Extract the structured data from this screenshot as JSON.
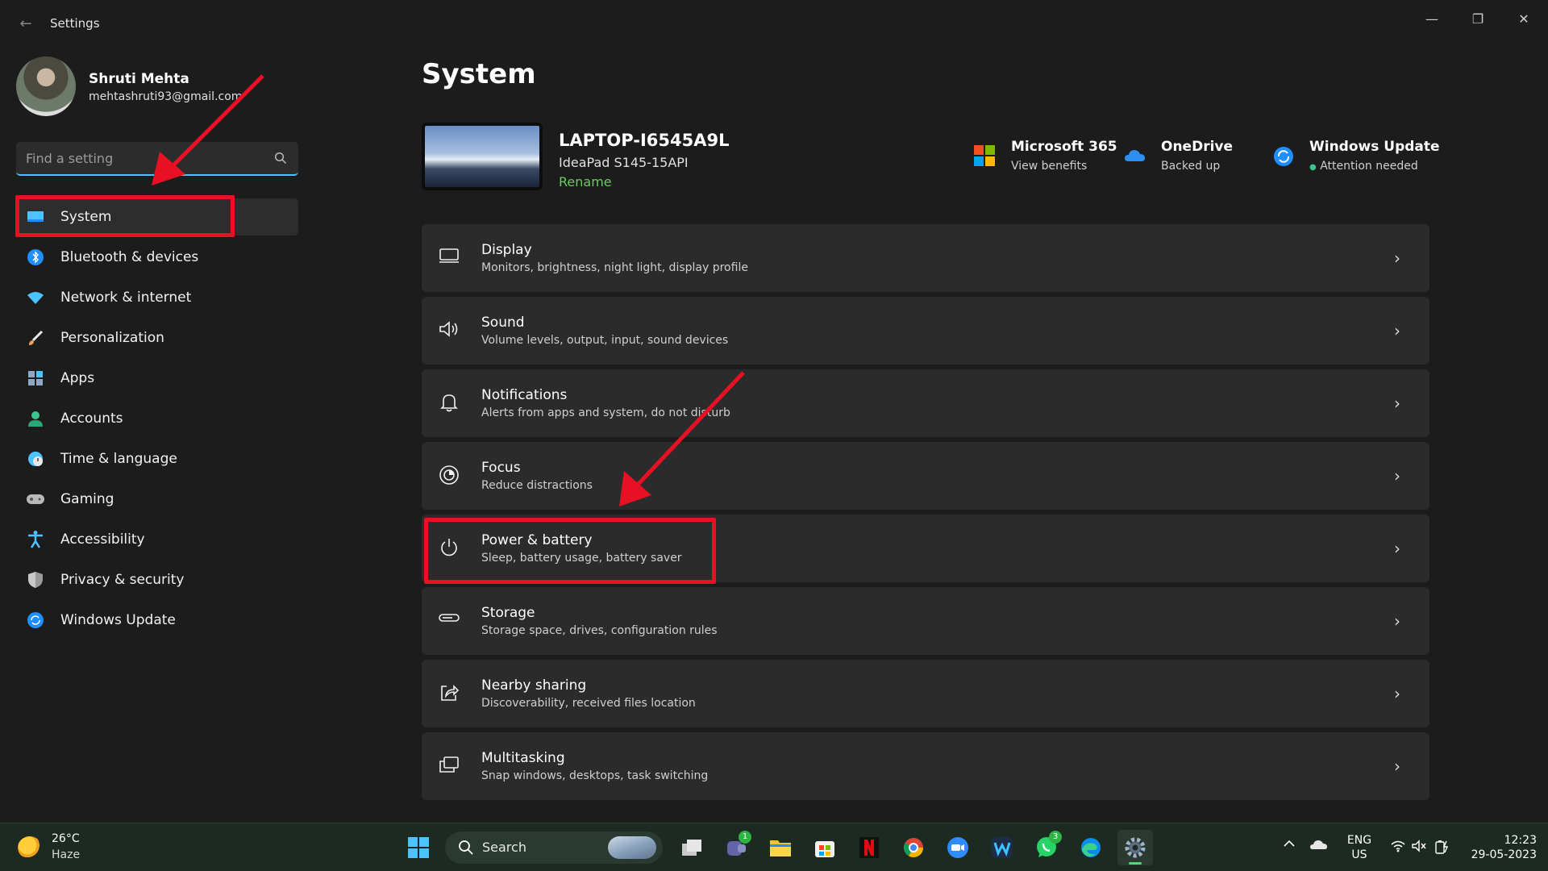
{
  "window": {
    "title": "Settings",
    "back": "←",
    "minimize": "—",
    "maximize": "❐",
    "close": "✕"
  },
  "profile": {
    "name": "Shruti Mehta",
    "email": "mehtashruti93@gmail.com"
  },
  "search": {
    "placeholder": "Find a setting"
  },
  "sidebar": {
    "items": [
      {
        "label": "System",
        "icon": "system-display-icon",
        "color": "#4cc2ff",
        "selected": true
      },
      {
        "label": "Bluetooth & devices",
        "icon": "bluetooth-icon",
        "color": "#1f8fff"
      },
      {
        "label": "Network & internet",
        "icon": "wifi-icon",
        "color": "#4cc2ff"
      },
      {
        "label": "Personalization",
        "icon": "brush-icon",
        "color": "#f0a25a"
      },
      {
        "label": "Apps",
        "icon": "apps-icon",
        "color": "#8fa6c8"
      },
      {
        "label": "Accounts",
        "icon": "person-icon",
        "color": "#3cc48c"
      },
      {
        "label": "Time & language",
        "icon": "globe-clock-icon",
        "color": "#4cc2ff"
      },
      {
        "label": "Gaming",
        "icon": "controller-icon",
        "color": "#b9b9b9"
      },
      {
        "label": "Accessibility",
        "icon": "accessibility-icon",
        "color": "#4cc2ff"
      },
      {
        "label": "Privacy & security",
        "icon": "shield-icon",
        "color": "#9a9a9a"
      },
      {
        "label": "Windows Update",
        "icon": "update-icon",
        "color": "#1f8fff"
      }
    ]
  },
  "main": {
    "title": "System",
    "device": {
      "name": "LAPTOP-I6545A9L",
      "model": "IdeaPad S145-15API",
      "rename": "Rename"
    },
    "tiles": [
      {
        "title": "Microsoft 365",
        "subtitle": "View benefits",
        "icon": "microsoft-365-icon"
      },
      {
        "title": "OneDrive",
        "subtitle": "Backed up",
        "icon": "onedrive-icon"
      },
      {
        "title": "Windows Update",
        "subtitle": "Attention needed",
        "icon": "windows-update-icon"
      }
    ],
    "cards": [
      {
        "title": "Display",
        "subtitle": "Monitors, brightness, night light, display profile",
        "icon": "display-icon",
        "glyph": "▭"
      },
      {
        "title": "Sound",
        "subtitle": "Volume levels, output, input, sound devices",
        "icon": "speaker-icon",
        "glyph": "🔊"
      },
      {
        "title": "Notifications",
        "subtitle": "Alerts from apps and system, do not disturb",
        "icon": "bell-icon",
        "glyph": "🔔"
      },
      {
        "title": "Focus",
        "subtitle": "Reduce distractions",
        "icon": "focus-icon",
        "glyph": "◎"
      },
      {
        "title": "Power & battery",
        "subtitle": "Sleep, battery usage, battery saver",
        "icon": "power-icon",
        "glyph": "⏻"
      },
      {
        "title": "Storage",
        "subtitle": "Storage space, drives, configuration rules",
        "icon": "storage-icon",
        "glyph": "▬"
      },
      {
        "title": "Nearby sharing",
        "subtitle": "Discoverability, received files location",
        "icon": "share-icon",
        "glyph": "↗"
      },
      {
        "title": "Multitasking",
        "subtitle": "Snap windows, desktops, task switching",
        "icon": "multitasking-icon",
        "glyph": "⧉"
      }
    ],
    "chevron": "›"
  },
  "taskbar": {
    "weather": {
      "temp": "26°C",
      "desc": "Haze"
    },
    "search_label": "Search",
    "apps": [
      {
        "name": "start-icon"
      },
      {
        "name": "search"
      },
      {
        "name": "task-view-icon"
      },
      {
        "name": "teams-icon",
        "badge": "1"
      },
      {
        "name": "file-explorer-icon"
      },
      {
        "name": "microsoft-store-icon"
      },
      {
        "name": "netflix-icon"
      },
      {
        "name": "chrome-icon"
      },
      {
        "name": "zoom-icon"
      },
      {
        "name": "webex-icon"
      },
      {
        "name": "whatsapp-icon",
        "badge": "3"
      },
      {
        "name": "edge-icon"
      },
      {
        "name": "settings-icon",
        "active": true
      }
    ],
    "tray": {
      "lang_top": "ENG",
      "lang_bottom": "US",
      "time": "12:23",
      "date": "29-05-2023"
    }
  },
  "colors": {
    "accent": "#4cc2ff",
    "rename_green": "#6ccb5f",
    "highlight_red": "#e81123"
  }
}
